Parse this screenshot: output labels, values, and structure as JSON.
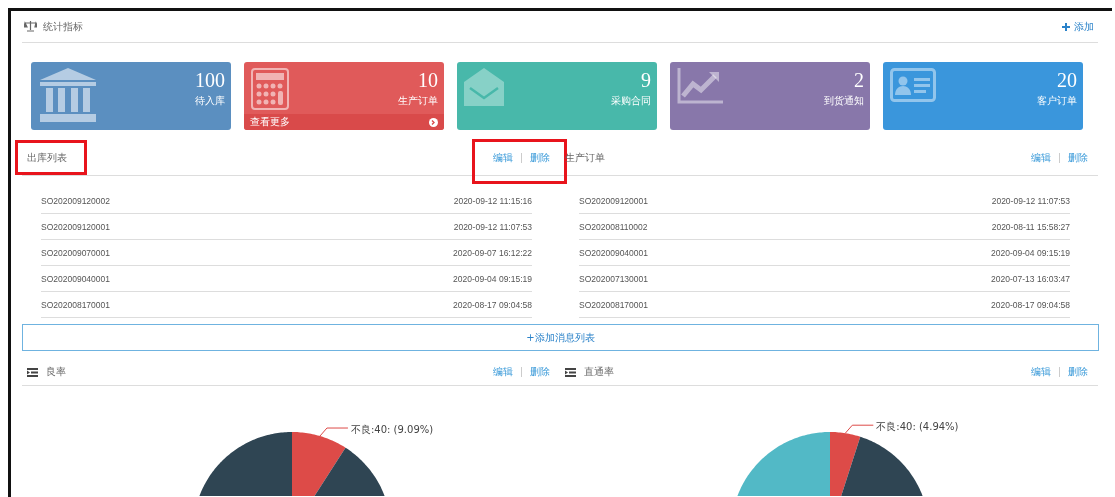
{
  "header": {
    "title": "统计指标",
    "add_label": "添加"
  },
  "cards": [
    {
      "value": "100",
      "label": "待入库",
      "color": "#5b8fc0",
      "kind": "bank"
    },
    {
      "value": "10",
      "label": "生产订单",
      "color": "#e05a5a",
      "kind": "calculator",
      "footer": "查看更多"
    },
    {
      "value": "9",
      "label": "采购合同",
      "color": "#48b8aa",
      "kind": "envelope"
    },
    {
      "value": "2",
      "label": "到货通知",
      "color": "#8877aa",
      "kind": "chart"
    },
    {
      "value": "20",
      "label": "客户订单",
      "color": "#3a96dc",
      "kind": "idcard"
    }
  ],
  "lists": [
    {
      "title": "出库列表",
      "title_highlighted": true,
      "actions_highlighted": true,
      "edit": "编辑",
      "delete": "删除",
      "rows": [
        {
          "code": "SO202009120002",
          "time": "2020-09-12 11:15:16"
        },
        {
          "code": "SO202009120001",
          "time": "2020-09-12 11:07:53"
        },
        {
          "code": "SO202009070001",
          "time": "2020-09-07 16:12:22"
        },
        {
          "code": "SO202009040001",
          "time": "2020-09-04 09:15:19"
        },
        {
          "code": "SO202008170001",
          "time": "2020-08-17 09:04:58"
        }
      ]
    },
    {
      "title": "生产订单",
      "title_highlighted": false,
      "actions_highlighted": false,
      "edit": "编辑",
      "delete": "删除",
      "rows": [
        {
          "code": "SO202009120001",
          "time": "2020-09-12 11:07:53"
        },
        {
          "code": "SO202008110002",
          "time": "2020-08-11 15:58:27"
        },
        {
          "code": "SO202009040001",
          "time": "2020-09-04 09:15:19"
        },
        {
          "code": "SO202007130001",
          "time": "2020-07-13 16:03:47"
        },
        {
          "code": "SO202008170001",
          "time": "2020-08-17 09:04:58"
        }
      ]
    }
  ],
  "add_list_button": "+添加消息列表",
  "charts": [
    {
      "title": "良率",
      "edit": "编辑",
      "delete": "删除",
      "slice_label": "不良:40: (9.09%)"
    },
    {
      "title": "直通率",
      "edit": "编辑",
      "delete": "删除",
      "slice_label": "不良:40: (4.94%)"
    }
  ]
}
